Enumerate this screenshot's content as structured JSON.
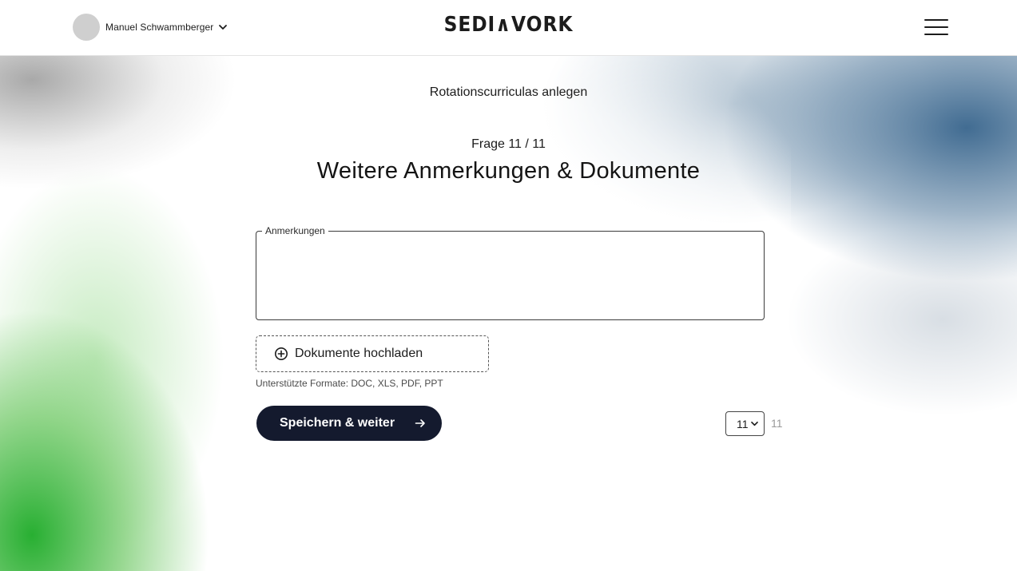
{
  "header": {
    "user_name": "Manuel Schwammberger",
    "logo_text": "SEDI∧VORK",
    "icons": {
      "user_menu": "chevron-down-icon",
      "menu": "hamburger-menu-icon"
    }
  },
  "main": {
    "page_title": "Rotationscurriculas anlegen",
    "counter": "Frage 11 / 11",
    "question": "Weitere Anmerkungen & Dokumente",
    "notes_label": "Anmerkungen",
    "notes_value": "",
    "upload_label": "Dokumente hochladen",
    "formats_hint": "Unterstützte Formate: DOC, XLS, PDF, PPT",
    "save_label": "Speichern & weiter",
    "page_select_value": "11",
    "page_total": "11",
    "icons": {
      "upload": "plus-circle-icon",
      "save": "arrow-right-icon",
      "select": "chevron-down-icon"
    }
  },
  "colors": {
    "button_bg": "#141a2e",
    "text": "#1c1c1c",
    "accent_green": "#28af32",
    "accent_blue": "#37648c"
  }
}
